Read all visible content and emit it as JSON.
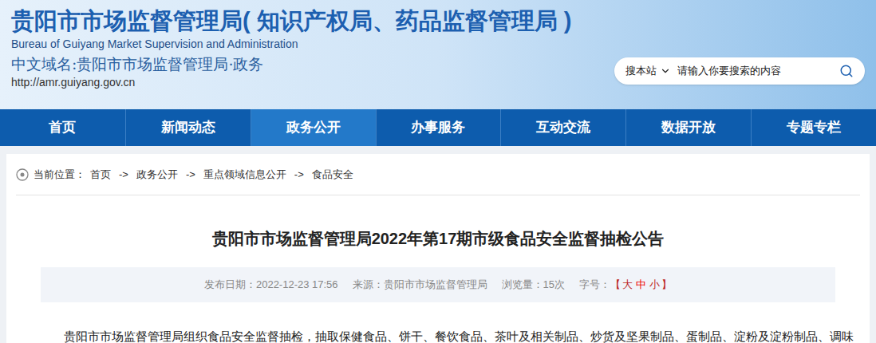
{
  "header": {
    "title": "贵阳市市场监督管理局( 知识产权局、药品监督管理局 )",
    "english": "Bureau of Guiyang Market Supervision and Administration",
    "domain": "中文域名:贵阳市市场监督管理局·政务",
    "url": "http://amr.guiyang.gov.cn"
  },
  "search": {
    "scope": "搜本站",
    "placeholder": "请输入你要搜索的内容"
  },
  "nav": [
    {
      "label": "首页",
      "selected": false
    },
    {
      "label": "新闻动态",
      "selected": false
    },
    {
      "label": "政务公开",
      "selected": true
    },
    {
      "label": "办事服务",
      "selected": false
    },
    {
      "label": "互动交流",
      "selected": false
    },
    {
      "label": "数据开放",
      "selected": false
    },
    {
      "label": "专题专栏",
      "selected": false
    }
  ],
  "breadcrumb": {
    "label": "当前位置：",
    "separator": "->",
    "items": [
      "首页",
      "政务公开",
      "重点领域信息公开",
      "食品安全"
    ]
  },
  "article": {
    "title": "贵阳市市场监督管理局2022年第17期市级食品安全监督抽检公告",
    "meta": [
      "发布日期：2022-12-23 17:56",
      "来源：贵阳市市场监督管理局",
      "浏览量：15次"
    ],
    "font_size": {
      "label": "字号：",
      "open": "【",
      "close": "】",
      "options": [
        {
          "label": "大",
          "selected": false
        },
        {
          "label": "中",
          "selected": true
        },
        {
          "label": "小",
          "selected": false
        }
      ]
    },
    "body": "贵阳市市场监督管理局组织食品安全监督抽检，抽取保健食品、饼干、餐饮食品、茶叶及相关制品、炒货及坚果制品、蛋制品、淀粉及淀粉制品、调味"
  }
}
